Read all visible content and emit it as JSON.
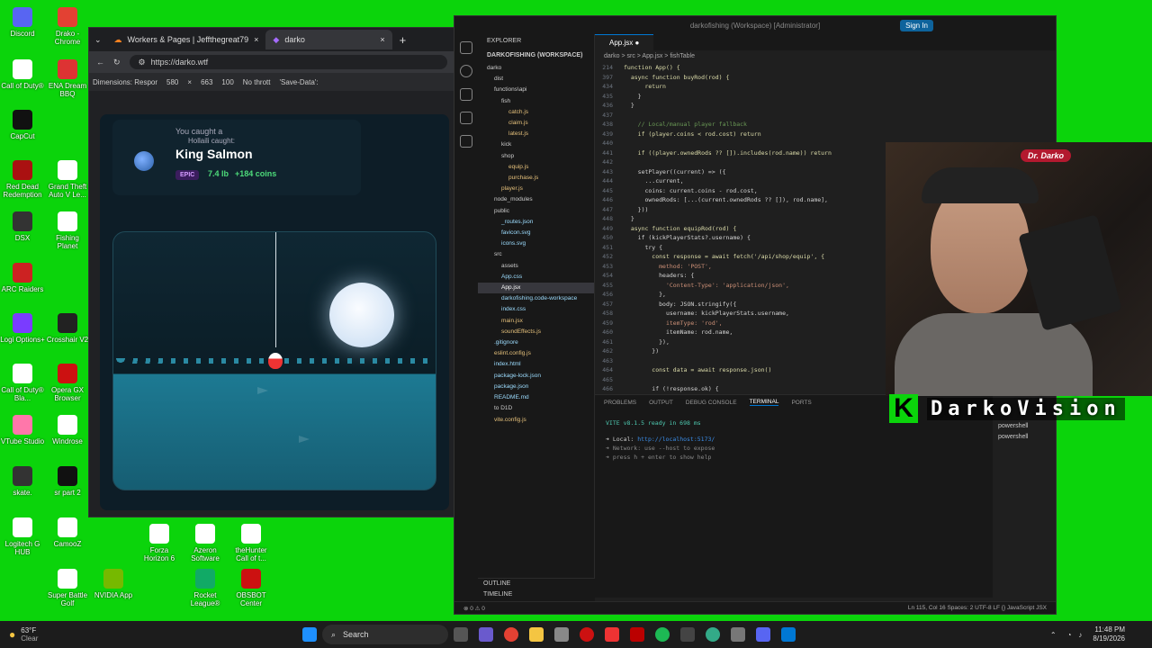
{
  "desktop": {
    "icons": [
      {
        "label": "Discord",
        "color": "#5865f2"
      },
      {
        "label": "Drako - Chrome",
        "color": "#e34133"
      },
      {
        "label": "Call of Duty®",
        "color": "#ffffff"
      },
      {
        "label": "ENA Dream BBQ",
        "color": "#d33"
      },
      {
        "label": "CapCut",
        "color": "#111"
      },
      {
        "label": "Red Dead Redemption",
        "color": "#a11"
      },
      {
        "label": "Grand Theft Auto V Le...",
        "color": "#fff"
      },
      {
        "label": "DSX",
        "color": "#333"
      },
      {
        "label": "Fishing Planet",
        "color": "#fff"
      },
      {
        "label": "ARC Raiders",
        "color": "#c22"
      },
      {
        "label": "Logi Options+",
        "color": "#7a3cff"
      },
      {
        "label": "Crosshair V2",
        "color": "#222"
      },
      {
        "label": "Call of Duty® Bla...",
        "color": "#fff"
      },
      {
        "label": "Opera GX Browser",
        "color": "#c11"
      },
      {
        "label": "VTube Studio",
        "color": "#f7a"
      },
      {
        "label": "Windrose",
        "color": "#fff"
      },
      {
        "label": "skate.",
        "color": "#333"
      },
      {
        "label": "sr part 2",
        "color": "#111"
      },
      {
        "label": "Logitech G HUB",
        "color": "#fff"
      },
      {
        "label": "CamooZ",
        "color": "#fff"
      },
      {
        "label": "Forza Horizon 6",
        "color": "#fff"
      },
      {
        "label": "Azeron Software",
        "color": "#fff"
      },
      {
        "label": "theHunter Call of t...",
        "color": "#fff"
      },
      {
        "label": "Super Battle Golf",
        "color": "#fff"
      },
      {
        "label": "NVIDIA App",
        "color": "#76b900"
      },
      {
        "label": "Rocket League®",
        "color": "#1a6"
      },
      {
        "label": "OBSBOT Center",
        "color": "#c11"
      }
    ]
  },
  "browser": {
    "tab1": "Workers & Pages | Jeffthegreat79",
    "tab2": "darko",
    "url": "https://darko.wtf",
    "devtools": {
      "dimensions": "Dimensions: Respor",
      "width": "580",
      "x": "×",
      "height": "663",
      "zoom": "100",
      "throttle": "No thrott",
      "save": "'Save-Data':"
    },
    "catch": {
      "heading": "You caught a",
      "player": "Hollaili caught:",
      "fish": "King Salmon",
      "rarity": "EPIC",
      "weight": "7.4 lb",
      "coins": "+184 coins"
    }
  },
  "vscode": {
    "title": "darkofishing (Workspace) [Administrator]",
    "signin": "Sign In",
    "explorer_title": "EXPLORER",
    "workspace": "DARKOFISHING (WORKSPACE)",
    "tree": [
      "darko",
      "dist",
      "functions\\api",
      "fish",
      "catch.js",
      "claim.js",
      "latest.js",
      "kick",
      "shop",
      "equip.js",
      "purchase.js",
      "player.js",
      "node_modules",
      "public",
      "_routes.json",
      "favicon.svg",
      "icons.svg",
      "src",
      "assets",
      "App.css",
      "App.jsx",
      "darkofishing.code-workspace",
      "index.css",
      "main.jsx",
      "soundEffects.js",
      ".gitignore",
      "eslint.config.js",
      "index.html",
      "package-lock.json",
      "package.json",
      "README.md",
      "to D1D",
      "vite.config.js"
    ],
    "tab": "App.jsx",
    "breadcrumb": "darko > src > App.jsx > fishTable",
    "code": [
      {
        "n": "214",
        "t": "function App() {"
      },
      {
        "n": "397",
        "t": "  async function buyRod(rod) {"
      },
      {
        "n": "434",
        "t": "      return"
      },
      {
        "n": "435",
        "t": "    }"
      },
      {
        "n": "436",
        "t": "  }"
      },
      {
        "n": "437",
        "t": ""
      },
      {
        "n": "438",
        "t": "    // Local/manual player fallback"
      },
      {
        "n": "439",
        "t": "    if (player.coins < rod.cost) return"
      },
      {
        "n": "440",
        "t": ""
      },
      {
        "n": "441",
        "t": "    if ((player.ownedRods ?? []).includes(rod.name)) return"
      },
      {
        "n": "442",
        "t": ""
      },
      {
        "n": "443",
        "t": "    setPlayer((current) => ({"
      },
      {
        "n": "444",
        "t": "      ...current,"
      },
      {
        "n": "445",
        "t": "      coins: current.coins - rod.cost,"
      },
      {
        "n": "446",
        "t": "      ownedRods: [...(current.ownedRods ?? []), rod.name],"
      },
      {
        "n": "447",
        "t": "    }))"
      },
      {
        "n": "448",
        "t": "  }"
      },
      {
        "n": "449",
        "t": "  async function equipRod(rod) {"
      },
      {
        "n": "450",
        "t": "    if (kickPlayerStats?.username) {"
      },
      {
        "n": "451",
        "t": "      try {"
      },
      {
        "n": "452",
        "t": "        const response = await fetch('/api/shop/equip', {"
      },
      {
        "n": "453",
        "t": "          method: 'POST',"
      },
      {
        "n": "454",
        "t": "          headers: {"
      },
      {
        "n": "455",
        "t": "            'Content-Type': 'application/json',"
      },
      {
        "n": "456",
        "t": "          },"
      },
      {
        "n": "457",
        "t": "          body: JSON.stringify({"
      },
      {
        "n": "458",
        "t": "            username: kickPlayerStats.username,"
      },
      {
        "n": "459",
        "t": "            itemType: 'rod',"
      },
      {
        "n": "460",
        "t": "            itemName: rod.name,"
      },
      {
        "n": "461",
        "t": "          }),"
      },
      {
        "n": "462",
        "t": "        })"
      },
      {
        "n": "463",
        "t": ""
      },
      {
        "n": "464",
        "t": "        const data = await response.json()"
      },
      {
        "n": "465",
        "t": ""
      },
      {
        "n": "466",
        "t": "        if (!response.ok) {"
      }
    ],
    "panel_tabs": [
      "PROBLEMS",
      "OUTPUT",
      "DEBUG CONSOLE",
      "TERMINAL",
      "PORTS"
    ],
    "terminal": {
      "vite": "VITE v8.1.5  ready in 698 ms",
      "local_label": "➜  Local:",
      "local_url": "http://localhost:5173/",
      "network": "➜  Network: use --host to expose",
      "help": "➜  press h + enter to show help"
    },
    "shells": [
      "powershell",
      "powershell"
    ],
    "outline": "OUTLINE",
    "timeline": "TIMELINE",
    "status_left": "⊗ 0 ⚠ 0",
    "status_right": "Ln 115, Col 16   Spaces: 2   UTF-8   LF   {} JavaScript JSX"
  },
  "webcam": {
    "badge": "Dr. Darko",
    "brand": "DarkoVision"
  },
  "taskbar": {
    "weather_temp": "63°F",
    "weather_desc": "Clear",
    "search": "Search",
    "time": "11:48 PM",
    "date": "8/19/2026"
  }
}
